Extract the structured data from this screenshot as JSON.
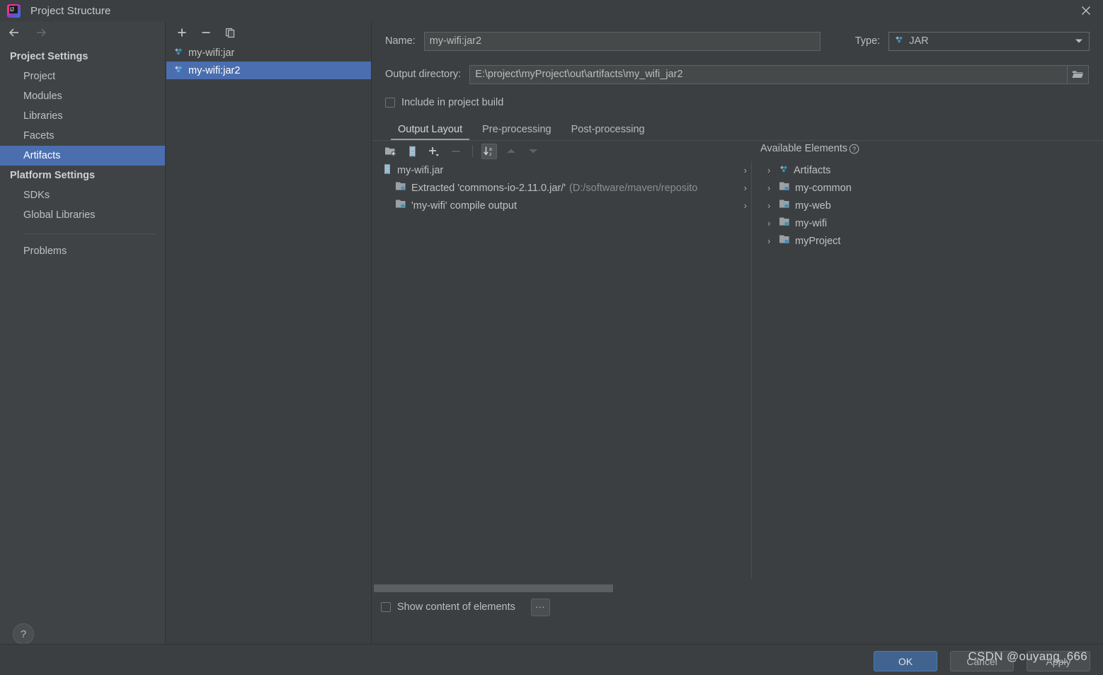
{
  "window": {
    "title": "Project Structure",
    "logo_icon": "intellij-idea-logo",
    "close_icon": "close-icon"
  },
  "nav": {
    "back_icon": "arrow-left-icon",
    "forward_icon": "arrow-right-icon"
  },
  "sidebar": {
    "groups": [
      {
        "label": "Project Settings",
        "items": [
          {
            "label": "Project",
            "selected": false
          },
          {
            "label": "Modules",
            "selected": false
          },
          {
            "label": "Libraries",
            "selected": false
          },
          {
            "label": "Facets",
            "selected": false
          },
          {
            "label": "Artifacts",
            "selected": true
          }
        ]
      },
      {
        "label": "Platform Settings",
        "items": [
          {
            "label": "SDKs",
            "selected": false
          },
          {
            "label": "Global Libraries",
            "selected": false
          }
        ]
      }
    ],
    "problems_label": "Problems",
    "help_label": "?"
  },
  "artifacts_panel": {
    "toolbar": [
      {
        "name": "add-artifact-button",
        "icon": "plus-icon"
      },
      {
        "name": "remove-artifact-button",
        "icon": "minus-icon"
      },
      {
        "name": "copy-artifact-button",
        "icon": "copy-icon"
      }
    ],
    "items": [
      {
        "label": "my-wifi:jar",
        "icon": "artifact-diamond-icon",
        "selected": false
      },
      {
        "label": "my-wifi:jar2",
        "icon": "artifact-diamond-icon",
        "selected": true
      }
    ]
  },
  "form": {
    "name_label": "Name:",
    "name_value": "my-wifi:jar2",
    "type_label": "Type:",
    "type_value": "JAR",
    "type_icon": "artifact-diamond-icon",
    "output_dir_label": "Output directory:",
    "output_dir_value": "E:\\project\\myProject\\out\\artifacts\\my_wifi_jar2",
    "browse_icon": "folder-open-icon",
    "include_in_build_label": "Include in project build",
    "include_in_build_checked": false
  },
  "tabs": [
    {
      "label": "Output Layout",
      "active": true
    },
    {
      "label": "Pre-processing",
      "active": false
    },
    {
      "label": "Post-processing",
      "active": false
    }
  ],
  "layout_toolbar": [
    {
      "name": "create-directory-button",
      "icon": "folder-add-icon",
      "state": "enabled"
    },
    {
      "name": "create-archive-button",
      "icon": "archive-icon",
      "state": "enabled"
    },
    {
      "name": "add-copy-of-button",
      "icon": "plus-dropdown-icon",
      "state": "enabled"
    },
    {
      "name": "remove-element-button",
      "icon": "minus-icon",
      "state": "disabled"
    },
    {
      "name": "sort-alphabetically-button",
      "icon": "sort-az-icon",
      "state": "active"
    },
    {
      "name": "move-up-button",
      "icon": "chevron-up-icon",
      "state": "disabled"
    },
    {
      "name": "move-down-button",
      "icon": "chevron-down-icon",
      "state": "disabled"
    }
  ],
  "output_layout_tree": [
    {
      "label": "my-wifi.jar",
      "icon": "archive-icon",
      "indent": 0,
      "suffix": "",
      "chevron": "›"
    },
    {
      "label": "Extracted 'commons-io-2.11.0.jar/'",
      "icon": "extracted-icon",
      "indent": 1,
      "suffix": "(D:/software/maven/reposito",
      "chevron": "›"
    },
    {
      "label": "'my-wifi' compile output",
      "icon": "module-output-icon",
      "indent": 1,
      "suffix": "",
      "chevron": "›"
    }
  ],
  "available_elements": {
    "header": "Available Elements",
    "help_icon": "question-circle-icon",
    "items": [
      {
        "label": "Artifacts",
        "icon": "artifact-diamond-icon",
        "expander": "›"
      },
      {
        "label": "my-common",
        "icon": "module-output-icon",
        "expander": "›"
      },
      {
        "label": "my-web",
        "icon": "module-output-icon",
        "expander": "›"
      },
      {
        "label": "my-wifi",
        "icon": "module-output-icon",
        "expander": "›"
      },
      {
        "label": "myProject",
        "icon": "module-output-icon",
        "expander": "›"
      }
    ]
  },
  "bottom": {
    "show_content_label": "Show content of elements",
    "show_content_checked": false,
    "dots_label": "..."
  },
  "footer": {
    "ok_label": "OK",
    "cancel_label": "Cancel",
    "apply_label": "Apply"
  },
  "watermark": "CSDN @ouyang_666",
  "colors": {
    "window_bg": "#3c3f41",
    "sidebar_bg": "#3f4346",
    "selection_blue": "#4b6eaf",
    "accent_cyan": "#3592c4",
    "primary_button": "#41638f",
    "text": "#bbbbbb",
    "muted_text": "#8d8d8d"
  }
}
